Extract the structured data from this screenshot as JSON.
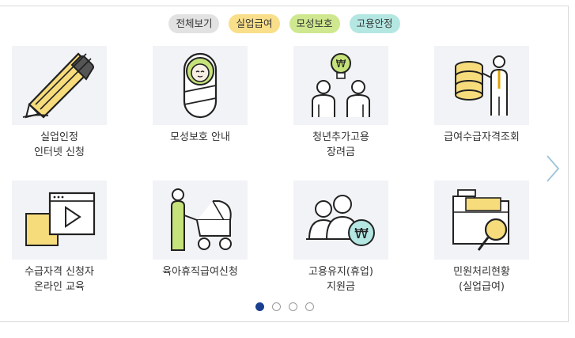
{
  "filters": [
    {
      "label": "전체보기"
    },
    {
      "label": "실업급여"
    },
    {
      "label": "모성보호"
    },
    {
      "label": "고용안정"
    }
  ],
  "tiles": [
    {
      "line1": "실업인정",
      "line2": "인터넷 신청",
      "icon": "pencil-icon"
    },
    {
      "line1": "모성보호 안내",
      "line2": "",
      "icon": "baby-icon"
    },
    {
      "line1": "청년추가고용",
      "line2": "장려금",
      "icon": "youth-won-idea-icon"
    },
    {
      "line1": "급여수급자격조회",
      "line2": "",
      "icon": "coins-person-icon"
    },
    {
      "line1": "수급자격 신청자",
      "line2": "온라인 교육",
      "icon": "video-play-icon"
    },
    {
      "line1": "육아휴직급여신청",
      "line2": "",
      "icon": "stroller-icon"
    },
    {
      "line1": "고용유지(휴업)",
      "line2": "지원금",
      "icon": "people-won-icon"
    },
    {
      "line1": "민원처리현황",
      "line2": "(실업급여)",
      "icon": "folder-search-icon"
    }
  ],
  "pagination": {
    "total": 4,
    "current": 1
  },
  "colors": {
    "accent_yellow": "#f9df8a",
    "accent_green": "#cfe88f",
    "accent_teal": "#b4e7e2",
    "active_dot": "#1a3f8f"
  }
}
